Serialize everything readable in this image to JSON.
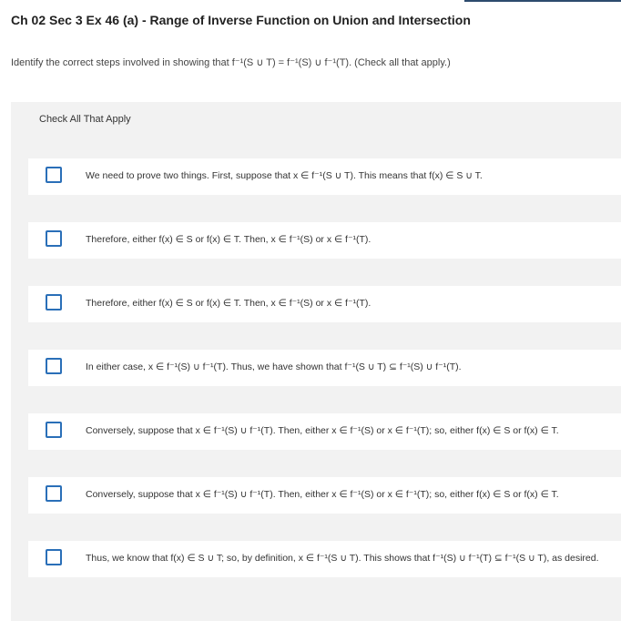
{
  "header": {
    "title": "Ch 02 Sec 3 Ex 46 (a) - Range of Inverse Function on Union and Intersection"
  },
  "question": {
    "instructions": "Identify the correct steps involved in showing that f⁻¹(S ∪ T) = f⁻¹(S) ∪ f⁻¹(T). (Check all that apply.)"
  },
  "panel": {
    "label": "Check All That Apply",
    "options": [
      {
        "text": "We need to prove two things. First, suppose that x ∈ f⁻¹(S ∪ T). This means that f(x) ∈ S ∪ T.",
        "checked": false
      },
      {
        "text": "Therefore, either f(x) ∈ S or f(x) ∈ T. Then, x ∈ f⁻¹(S) or x ∈ f⁻¹(T).",
        "checked": false
      },
      {
        "text": "Therefore, either f(x) ∈ S or f(x) ∈ T. Then, x ∈ f⁻¹(S) or x ∈ f⁻¹(T).",
        "checked": false
      },
      {
        "text": "In either case, x ∈ f⁻¹(S) ∪ f⁻¹(T). Thus, we have shown that f⁻¹(S ∪ T) ⊆ f⁻¹(S) ∪ f⁻¹(T).",
        "checked": false
      },
      {
        "text": "Conversely, suppose that x ∈ f⁻¹(S) ∪ f⁻¹(T). Then, either x ∈ f⁻¹(S) or x ∈ f⁻¹(T); so, either f(x) ∈ S or f(x) ∈ T.",
        "checked": false
      },
      {
        "text": "Conversely, suppose that x ∈ f⁻¹(S) ∪ f⁻¹(T). Then, either x ∈ f⁻¹(S) or x ∈ f⁻¹(T); so, either f(x) ∈ S or f(x) ∈ T.",
        "checked": false
      },
      {
        "text": "Thus, we know that f(x) ∈ S ∪ T; so, by definition, x ∈ f⁻¹(S ∪ T). This shows that f⁻¹(S) ∪ f⁻¹(T) ⊆ f⁻¹(S ∪ T), as desired.",
        "checked": false
      }
    ]
  },
  "colors": {
    "checkbox_border": "#2a6fb8",
    "panel_bg": "#f2f2f2",
    "accent_bar": "#2d4b6e"
  }
}
